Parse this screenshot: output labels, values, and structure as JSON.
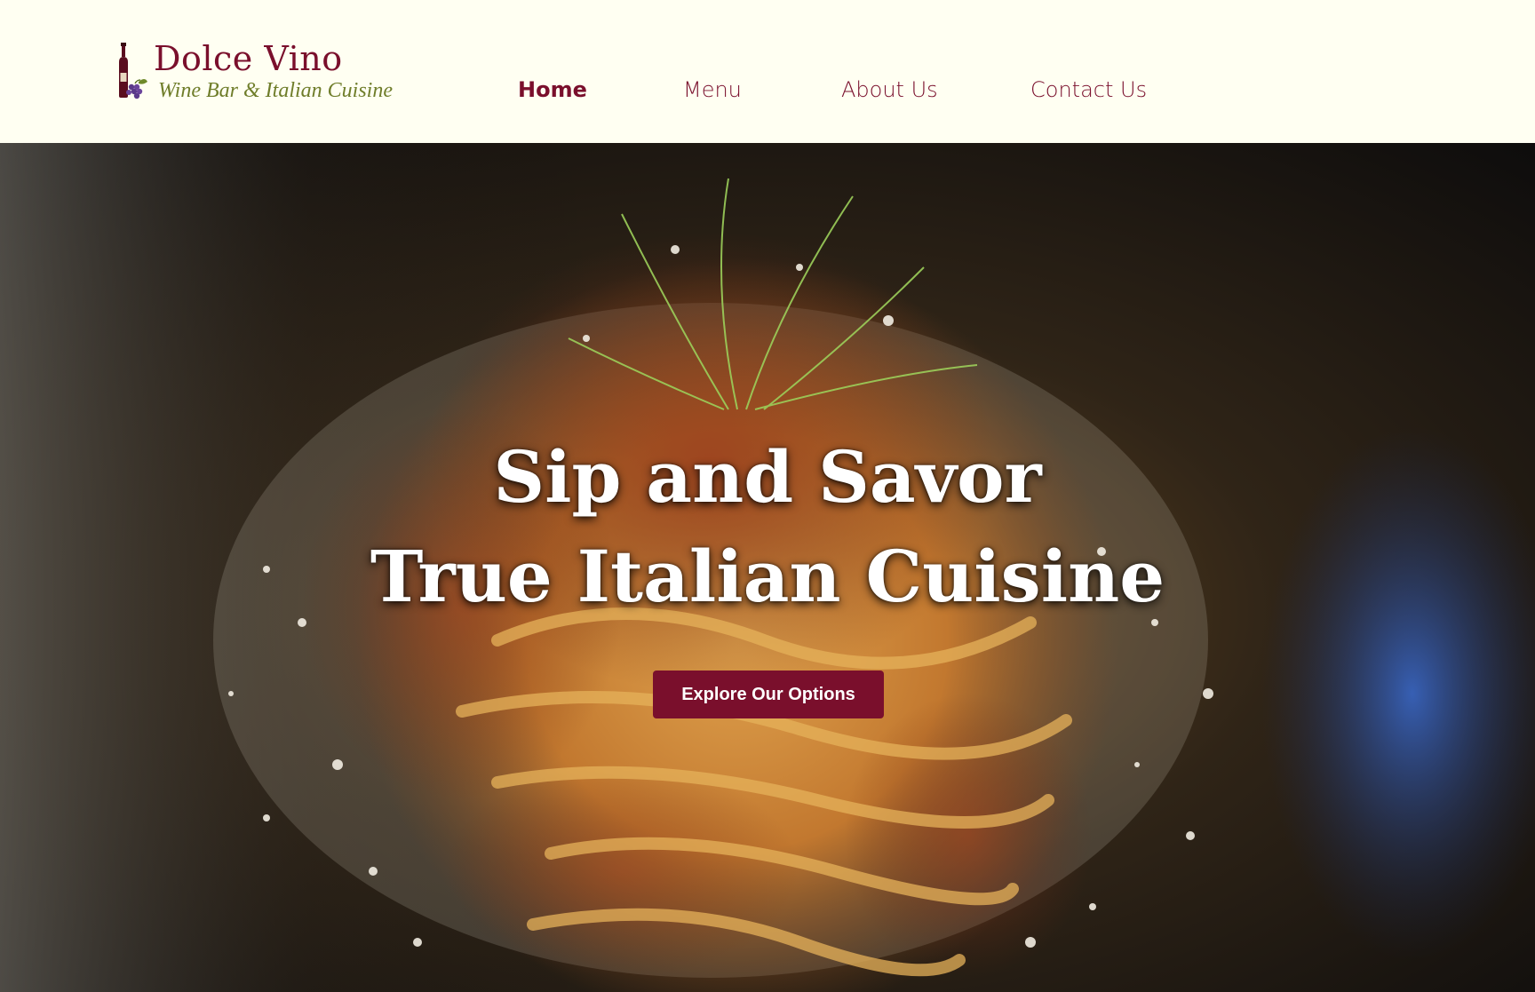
{
  "brand": {
    "name": "Dolce Vino",
    "tagline": "Wine Bar & Italian Cuisine",
    "logo_icon": "wine-bottle-grapes-icon",
    "colors": {
      "wine": "#7a0f2c",
      "olive": "#6f7d2a",
      "cream": "#fffff2"
    }
  },
  "nav": {
    "items": [
      {
        "label": "Home",
        "active": true
      },
      {
        "label": "Menu",
        "active": false
      },
      {
        "label": "About Us",
        "active": false
      },
      {
        "label": "Contact Us",
        "active": false
      }
    ]
  },
  "hero": {
    "headline_line1": "Sip and Savor",
    "headline_line2": "True Italian Cuisine",
    "cta_label": "Explore Our Options",
    "image": "pasta-bolognese-photo"
  }
}
